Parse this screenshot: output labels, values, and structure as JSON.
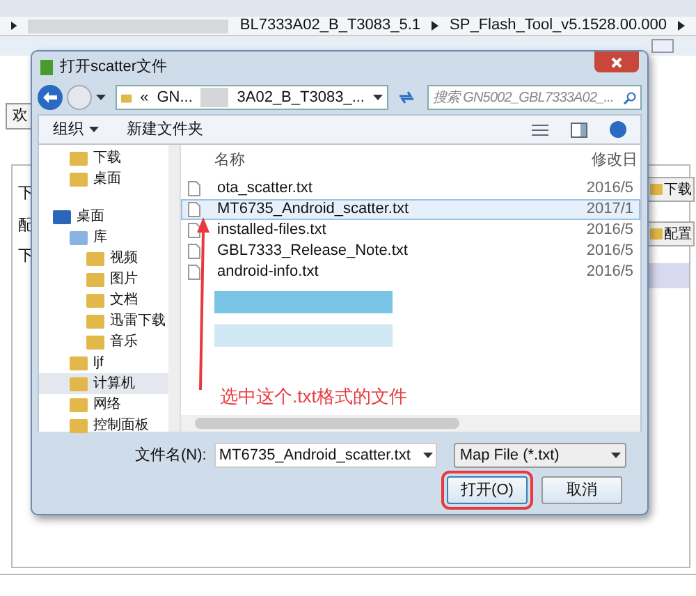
{
  "background_window": {
    "breadcrumb": [
      "BL7333A02_B_T3083_5.1",
      "SP_Flash_Tool_v5.1528.00.000"
    ],
    "tab": "欢",
    "left_labels": [
      "下",
      "配",
      "下"
    ],
    "side_buttons": [
      "下载",
      "配置"
    ]
  },
  "dialog": {
    "title": "打开scatter文件",
    "path": [
      "«",
      "GN...",
      "3A02_B_T3083_..."
    ],
    "search": {
      "placeholder": "搜索 GN5002_GBL7333A02_..."
    },
    "toolbar": [
      "组织",
      "新建文件夹"
    ],
    "nav_sections": [
      {
        "items": [
          {
            "label": "下载",
            "selected": false
          },
          {
            "label": "桌面",
            "selected": false
          }
        ]
      },
      {
        "items": [
          {
            "label": "桌面",
            "selected": false,
            "children": [
              {
                "label": "库",
                "selected": false,
                "children": [
                  {
                    "label": "视频",
                    "selected": false
                  },
                  {
                    "label": "图片",
                    "selected": false
                  },
                  {
                    "label": "文档",
                    "selected": false
                  },
                  {
                    "label": "迅雷下载",
                    "selected": false
                  },
                  {
                    "label": "音乐",
                    "selected": false
                  }
                ]
              },
              {
                "label": "ljf",
                "selected": false
              },
              {
                "label": "计算机",
                "selected": true
              },
              {
                "label": "网络",
                "selected": false
              },
              {
                "label": "控制面板",
                "selected": false
              }
            ]
          }
        ]
      }
    ],
    "columns": [
      "名称",
      "修改日"
    ],
    "files": [
      {
        "name": "ota_scatter.txt",
        "date": "2016/5",
        "selected": false
      },
      {
        "name": "MT6735_Android_scatter.txt",
        "date": "2017/1",
        "selected": true
      },
      {
        "name": "installed-files.txt",
        "date": "2016/5",
        "selected": false
      },
      {
        "name": "GBL7333_Release_Note.txt",
        "date": "2016/5",
        "selected": false
      },
      {
        "name": "android-info.txt",
        "date": "2016/5",
        "selected": false
      }
    ],
    "filename_label": "文件名(N):",
    "filename": "MT6735_Android_scatter.txt",
    "filter": "Map File (*.txt)",
    "buttons": [
      {
        "label": "打开(O)",
        "highlighted": true
      },
      {
        "label": "取消",
        "highlighted": false
      }
    ]
  },
  "annotation": "选中这个.txt格式的文件"
}
